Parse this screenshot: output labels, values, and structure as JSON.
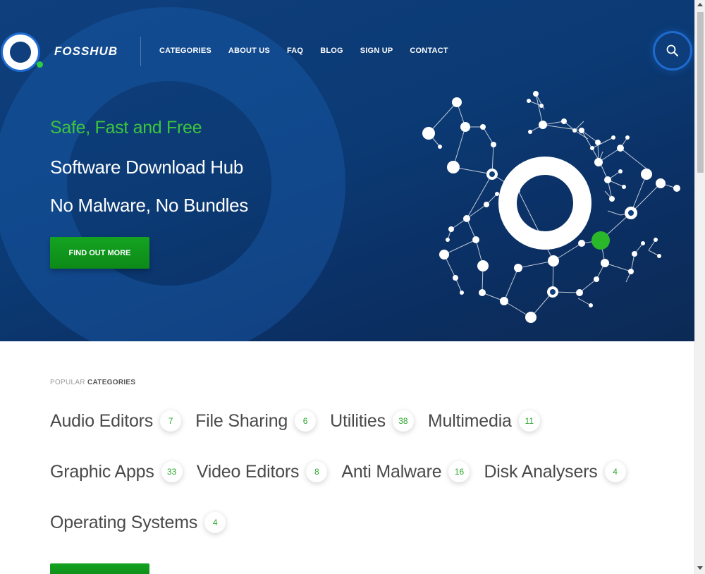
{
  "brand": {
    "logo_text": "FOSSHUB",
    "accent_green": "#2ecc40",
    "hero_blue": "#0f3f7d"
  },
  "nav": {
    "items": [
      {
        "label": "CATEGORIES"
      },
      {
        "label": "ABOUT US"
      },
      {
        "label": "FAQ"
      },
      {
        "label": "BLOG"
      },
      {
        "label": "SIGN UP"
      },
      {
        "label": "CONTACT"
      }
    ],
    "search_icon": "search-icon"
  },
  "hero": {
    "line1": "Safe, Fast and Free",
    "line2": "Software Download Hub",
    "line3": "No Malware, No Bundles",
    "cta_label": "FIND OUT MORE"
  },
  "popular": {
    "label_light": "POPULAR ",
    "label_bold": "CATEGORIES",
    "categories": [
      {
        "name": "Audio Editors",
        "count": "7"
      },
      {
        "name": "File Sharing",
        "count": "6"
      },
      {
        "name": "Utilities",
        "count": "38"
      },
      {
        "name": "Multimedia",
        "count": "11"
      },
      {
        "name": "Graphic Apps",
        "count": "33"
      },
      {
        "name": "Video Editors",
        "count": "8"
      },
      {
        "name": "Anti Malware",
        "count": "16"
      },
      {
        "name": "Disk Analysers",
        "count": "4"
      },
      {
        "name": "Operating Systems",
        "count": "4"
      }
    ]
  }
}
